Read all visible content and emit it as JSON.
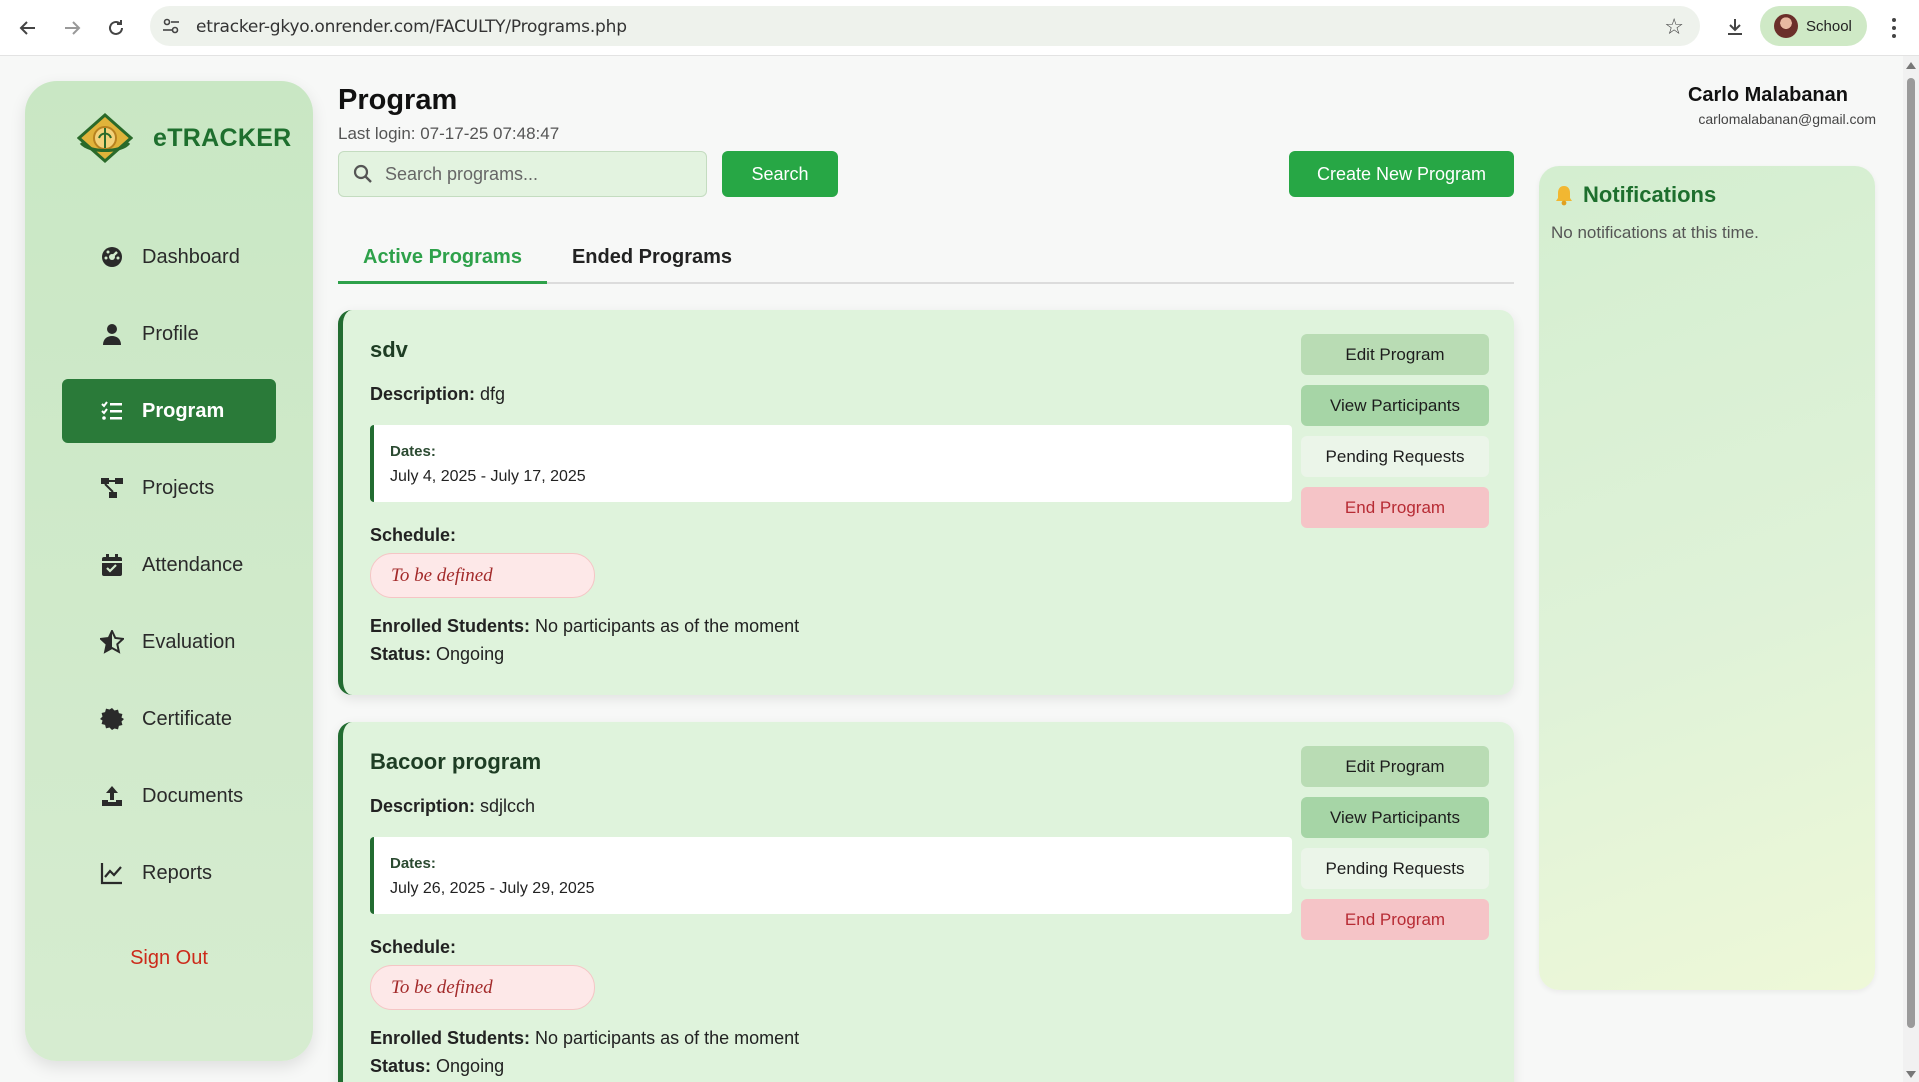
{
  "browser": {
    "url": "etracker-gkyo.onrender.com/FACULTY/Programs.php",
    "profile_label": "School"
  },
  "sidebar": {
    "brand": "eTRACKER",
    "items": [
      {
        "label": "Dashboard",
        "icon": "dashboard-gauge-icon"
      },
      {
        "label": "Profile",
        "icon": "user-icon"
      },
      {
        "label": "Program",
        "icon": "list-check-icon",
        "active": true
      },
      {
        "label": "Projects",
        "icon": "project-diagram-icon"
      },
      {
        "label": "Attendance",
        "icon": "calendar-check-icon"
      },
      {
        "label": "Evaluation",
        "icon": "star-half-icon"
      },
      {
        "label": "Certificate",
        "icon": "certificate-icon"
      },
      {
        "label": "Documents",
        "icon": "upload-icon"
      },
      {
        "label": "Reports",
        "icon": "line-chart-icon"
      }
    ],
    "signout_label": "Sign Out"
  },
  "header": {
    "title": "Program",
    "last_login": "Last login: 07-17-25 07:48:47",
    "search_placeholder": "Search programs...",
    "search_button": "Search",
    "create_button": "Create New Program",
    "user_name": "Carlo Malabanan",
    "user_email": "carlomalabanan@gmail.com"
  },
  "tabs": [
    {
      "label": "Active Programs",
      "active": true
    },
    {
      "label": "Ended Programs",
      "active": false
    }
  ],
  "labels": {
    "description": "Description:",
    "dates": "Dates:",
    "schedule": "Schedule:",
    "enrolled": "Enrolled Students:",
    "status": "Status:"
  },
  "actions": {
    "edit": "Edit Program",
    "view": "View Participants",
    "pending": "Pending Requests",
    "end": "End Program"
  },
  "programs": [
    {
      "title": "sdv",
      "description": "dfg",
      "dates": "July 4, 2025 - July 17, 2025",
      "schedule": "To be defined",
      "enrolled": "No participants as of the moment",
      "status": "Ongoing"
    },
    {
      "title": "Bacoor program",
      "description": "sdjlcch",
      "dates": "July 26, 2025 - July 29, 2025",
      "schedule": "To be defined",
      "enrolled": "No participants as of the moment",
      "status": "Ongoing"
    }
  ],
  "notifications": {
    "title": "Notifications",
    "empty_text": "No notifications at this time.",
    "icon": "bell-icon"
  },
  "colors": {
    "primary_green": "#27a745",
    "sidebar_active": "#2a7a39",
    "card_bg": "#dff3dc",
    "danger": "#cc2a1a"
  }
}
